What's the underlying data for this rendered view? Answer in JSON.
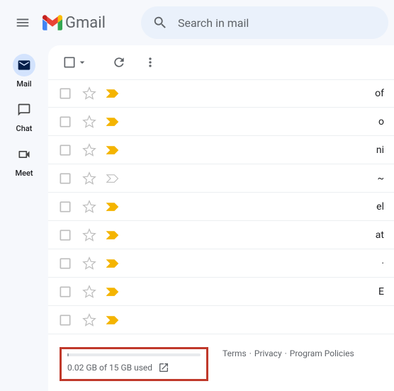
{
  "header": {
    "brand": "Gmail",
    "search_placeholder": "Search in mail"
  },
  "nav": [
    {
      "label": "Mail",
      "icon": "mail",
      "selected": true
    },
    {
      "label": "Chat",
      "icon": "chat",
      "selected": false
    },
    {
      "label": "Meet",
      "icon": "meet",
      "selected": false
    }
  ],
  "rows": [
    {
      "important": true,
      "filled": true,
      "snip": "of"
    },
    {
      "important": true,
      "filled": true,
      "snip": "o"
    },
    {
      "important": true,
      "filled": true,
      "snip": "ni"
    },
    {
      "important": false,
      "filled": false,
      "snip": "~"
    },
    {
      "important": true,
      "filled": true,
      "snip": "el"
    },
    {
      "important": true,
      "filled": true,
      "snip": "at"
    },
    {
      "important": true,
      "filled": true,
      "snip": "·"
    },
    {
      "important": true,
      "filled": true,
      "snip": "E"
    },
    {
      "important": true,
      "filled": true,
      "snip": ""
    },
    {
      "important": true,
      "filled": true,
      "snip": ""
    }
  ],
  "storage": {
    "text": "0.02 GB of 15 GB used"
  },
  "footer_links": {
    "terms": "Terms",
    "privacy": "Privacy",
    "policies": "Program Policies"
  }
}
